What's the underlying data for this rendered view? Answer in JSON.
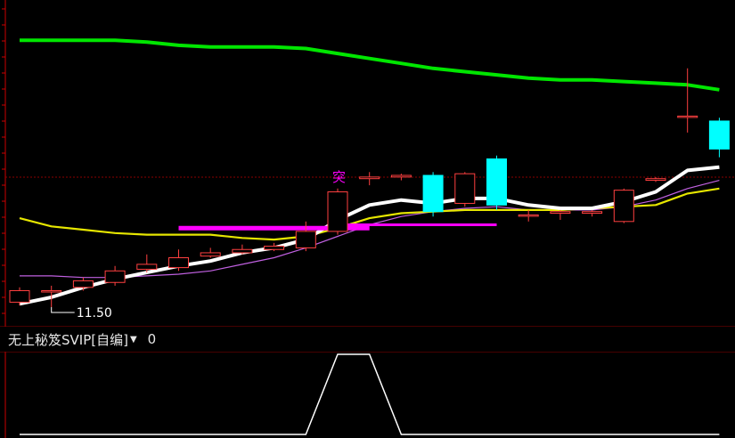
{
  "chart_data": [
    {
      "type": "candlestick",
      "price_label": "11.50",
      "signal_label": "突",
      "colors": {
        "up": "#ff4040",
        "down": "#00ffff",
        "price_axis_line": "#cc0000",
        "grid": "#8b0000",
        "long_ma": "#00e600",
        "ma_white": "#ffffff",
        "ma_yellow": "#e6e600",
        "ma_violet": "#c060e0",
        "signal_magenta": "#ff00ff"
      },
      "candles": [
        {
          "open": 11.53,
          "close": 11.6,
          "high": 11.62,
          "low": 11.51
        },
        {
          "open": 11.6,
          "close": 11.6,
          "high": 11.63,
          "low": 11.5
        },
        {
          "open": 11.62,
          "close": 11.66,
          "high": 11.68,
          "low": 11.6
        },
        {
          "open": 11.65,
          "close": 11.72,
          "high": 11.75,
          "low": 11.63
        },
        {
          "open": 11.73,
          "close": 11.76,
          "high": 11.82,
          "low": 11.71
        },
        {
          "open": 11.74,
          "close": 11.8,
          "high": 11.85,
          "low": 11.72
        },
        {
          "open": 11.81,
          "close": 11.83,
          "high": 11.86,
          "low": 11.8
        },
        {
          "open": 11.83,
          "close": 11.85,
          "high": 11.88,
          "low": 11.82
        },
        {
          "open": 11.85,
          "close": 11.87,
          "high": 11.89,
          "low": 11.84
        },
        {
          "open": 11.86,
          "close": 11.96,
          "high": 12.02,
          "low": 11.84
        },
        {
          "open": 11.96,
          "close": 12.2,
          "high": 12.22,
          "low": 11.94
        },
        {
          "open": 12.28,
          "close": 12.29,
          "high": 12.32,
          "low": 12.24
        },
        {
          "open": 12.29,
          "close": 12.3,
          "high": 12.31,
          "low": 12.27
        },
        {
          "open": 12.3,
          "close": 12.08,
          "high": 12.32,
          "low": 12.05
        },
        {
          "open": 12.13,
          "close": 12.31,
          "high": 12.32,
          "low": 12.11
        },
        {
          "open": 12.4,
          "close": 12.12,
          "high": 12.42,
          "low": 12.09
        },
        {
          "open": 12.06,
          "close": 12.06,
          "high": 12.09,
          "low": 12.02
        },
        {
          "open": 12.07,
          "close": 12.08,
          "high": 12.09,
          "low": 12.03
        },
        {
          "open": 12.07,
          "close": 12.08,
          "high": 12.09,
          "low": 12.05
        },
        {
          "open": 12.02,
          "close": 12.21,
          "high": 12.22,
          "low": 12.01
        },
        {
          "open": 12.27,
          "close": 12.28,
          "high": 12.29,
          "low": 12.26
        },
        {
          "open": 12.66,
          "close": 12.66,
          "high": 12.95,
          "low": 12.56
        },
        {
          "open": 12.63,
          "close": 12.46,
          "high": 12.65,
          "low": 12.41
        }
      ],
      "ma_white": [
        11.52,
        11.56,
        11.62,
        11.67,
        11.71,
        11.75,
        11.78,
        11.83,
        11.86,
        11.91,
        12.03,
        12.12,
        12.15,
        12.13,
        12.16,
        12.16,
        12.12,
        12.1,
        12.1,
        12.14,
        12.2,
        12.33,
        12.35
      ],
      "ma_yellow": [
        12.04,
        11.99,
        11.97,
        11.95,
        11.94,
        11.94,
        11.94,
        11.92,
        11.91,
        11.93,
        11.98,
        12.04,
        12.07,
        12.08,
        12.09,
        12.09,
        12.09,
        12.09,
        12.1,
        12.11,
        12.12,
        12.19,
        12.22
      ],
      "ma_violet": [
        11.69,
        11.69,
        11.68,
        11.68,
        11.69,
        11.7,
        11.72,
        11.76,
        11.8,
        11.86,
        11.93,
        12.0,
        12.05,
        12.08,
        12.1,
        12.11,
        12.09,
        12.09,
        12.09,
        12.11,
        12.15,
        12.22,
        12.27
      ],
      "long_ma": [
        13.12,
        13.12,
        13.12,
        13.12,
        13.11,
        13.09,
        13.08,
        13.08,
        13.08,
        13.07,
        13.04,
        13.01,
        12.98,
        12.95,
        12.93,
        12.91,
        12.89,
        12.88,
        12.88,
        12.87,
        12.86,
        12.85,
        12.82
      ],
      "signal_segments": [
        {
          "from": 5,
          "to": 11,
          "price": 11.98
        },
        {
          "from": 10,
          "to": 15,
          "price": 12.0
        }
      ],
      "signal_label_index": 10
    },
    {
      "type": "line",
      "indicator_name": "无上秘笈SVIP[自编]",
      "indicator_value": "0",
      "values": [
        0,
        0,
        0,
        0,
        0,
        0,
        0,
        0,
        0,
        0,
        1,
        1,
        0,
        0,
        0,
        0,
        0,
        0,
        0,
        0,
        0,
        0,
        0
      ]
    }
  ]
}
